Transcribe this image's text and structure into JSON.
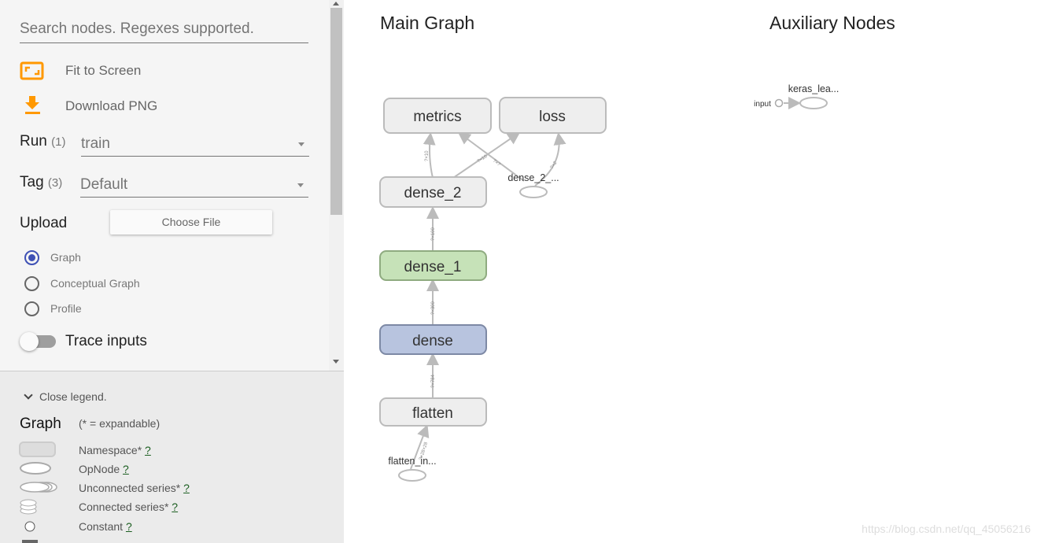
{
  "sidebar": {
    "search_placeholder": "Search nodes. Regexes supported.",
    "fit_to_screen": "Fit to Screen",
    "download_png": "Download PNG",
    "run_label": "Run",
    "run_count": "(1)",
    "run_value": "train",
    "tag_label": "Tag",
    "tag_count": "(3)",
    "tag_value": "Default",
    "upload_label": "Upload",
    "choose_file": "Choose File",
    "radios": [
      {
        "label": "Graph",
        "checked": true
      },
      {
        "label": "Conceptual Graph",
        "checked": false
      },
      {
        "label": "Profile",
        "checked": false
      }
    ],
    "trace_inputs": "Trace inputs",
    "trace_inputs_on": false
  },
  "legend": {
    "close": "Close legend.",
    "title": "Graph",
    "note": "(* = expandable)",
    "items": [
      {
        "label": "Namespace*",
        "help": "?"
      },
      {
        "label": "OpNode",
        "help": "?"
      },
      {
        "label": "Unconnected series*",
        "help": "?"
      },
      {
        "label": "Connected series*",
        "help": "?"
      },
      {
        "label": "Constant",
        "help": "?"
      }
    ]
  },
  "main": {
    "title": "Main Graph",
    "nodes": {
      "metrics": "metrics",
      "loss": "loss",
      "dense_2": "dense_2",
      "dense_2_op": "dense_2_...",
      "dense_1": "dense_1",
      "dense": "dense",
      "flatten": "flatten",
      "flatten_input": "flatten_in..."
    },
    "edges": {
      "d2_metrics": "?×10",
      "d2_loss": "?×10",
      "op_metrics": "?×?",
      "op_loss": "?×2",
      "d1_d2": "?×100",
      "d_d1": "?×300",
      "f_d": "?×784",
      "in_f": "?×28×28"
    },
    "colors": {
      "dense_1": "#c6e2b8",
      "dense": "#b8c4df",
      "namespace": "#eeeeee"
    }
  },
  "aux": {
    "title": "Auxiliary Nodes",
    "input": "input",
    "keras": "keras_lea..."
  },
  "watermark": "https://blog.csdn.net/qq_45056216"
}
